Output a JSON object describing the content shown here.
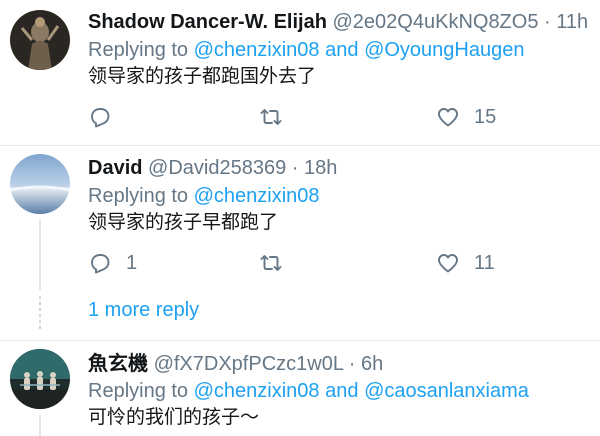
{
  "tweets": [
    {
      "name": "Shadow Dancer-W. Elijah",
      "handle": "@2e02Q4uKkNQ8ZO5",
      "dot": "·",
      "time": "11h",
      "replying_prefix": "Replying to",
      "mention1": "@chenzixin08",
      "and": "and",
      "mention2": "@OyoungHaugen",
      "text": "领导家的孩子都跑国外去了",
      "reply_count": "",
      "retweet_count": "",
      "like_count": "15"
    },
    {
      "name": "David",
      "handle": "@David258369",
      "dot": "·",
      "time": "18h",
      "replying_prefix": "Replying to",
      "mention1": "@chenzixin08",
      "text": "领导家的孩子早都跑了",
      "reply_count": "1",
      "retweet_count": "",
      "like_count": "11"
    },
    {
      "name": "魚玄機",
      "handle": "@fX7DXpfPCzc1w0L",
      "dot": "·",
      "time": "6h",
      "replying_prefix": "Replying to",
      "mention1": "@chenzixin08",
      "and": "and",
      "mention2": "@caosanlanxiama",
      "text": "可怜的我们的孩子～"
    }
  ],
  "more_replies": "1 more reply",
  "icons": {
    "reply": "reply-icon",
    "retweet": "retweet-icon",
    "like": "heart-icon"
  },
  "colors": {
    "link": "#1da1f2",
    "muted": "#657786",
    "text": "#14171a"
  }
}
